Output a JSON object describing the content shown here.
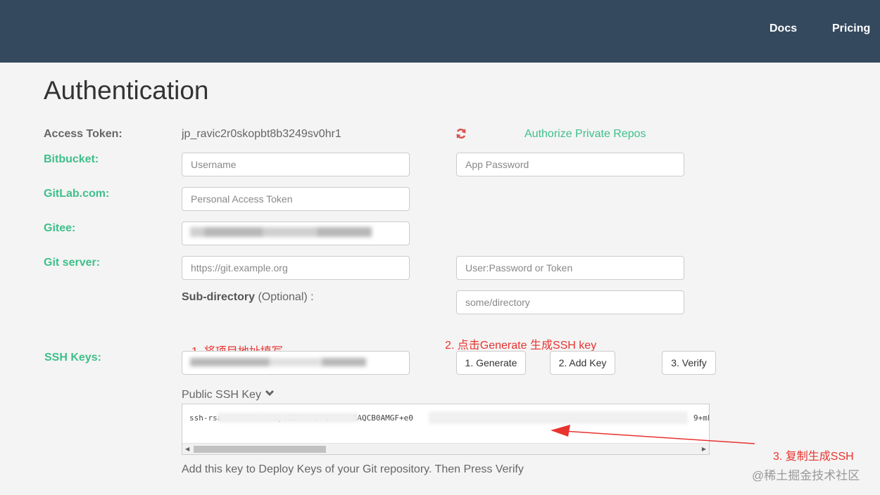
{
  "nav": {
    "docs": "Docs",
    "pricing": "Pricing"
  },
  "page": {
    "title": "Authentication"
  },
  "access_token": {
    "label": "Access Token:",
    "value": "jp_ravic2r0skopbt8b3249sv0hr1",
    "refresh_icon": "refresh-icon",
    "authorize_link": "Authorize Private Repos"
  },
  "bitbucket": {
    "label": "Bitbucket:",
    "username_placeholder": "Username",
    "password_placeholder": "App Password"
  },
  "gitlab": {
    "label": "GitLab.com:",
    "token_placeholder": "Personal Access Token"
  },
  "gitee": {
    "label": "Gitee:"
  },
  "git_server": {
    "label": "Git server:",
    "url_placeholder": "https://git.example.org",
    "cred_placeholder": "User:Password or Token",
    "subdir_label_bold": "Sub-directory",
    "subdir_label_rest": " (Optional) :",
    "subdir_placeholder": "some/directory"
  },
  "ssh": {
    "label": "SSH Keys:",
    "generate": "1. Generate",
    "add_key": "2. Add Key",
    "verify": "3. Verify",
    "public_key_label": "Public SSH Key",
    "public_key_text": "ssh-rsa AAAAB3NzaC1yc2EAAAADAQABAAABAQCB0AMGF+e0",
    "public_key_tail": "9+mF",
    "hint": "Add this key to Deploy Keys of your Git repository. Then Press Verify"
  },
  "annotations": {
    "step1": "1. 将项目地址填写",
    "step2": "2. 点击Generate 生成SSH key",
    "step3": "3. 复制生成SSH"
  },
  "watermark": "@稀土掘金技术社区",
  "colors": {
    "header_bg": "#34495e",
    "accent_green": "#3fbf8a",
    "annotation_red": "#e8332e"
  }
}
